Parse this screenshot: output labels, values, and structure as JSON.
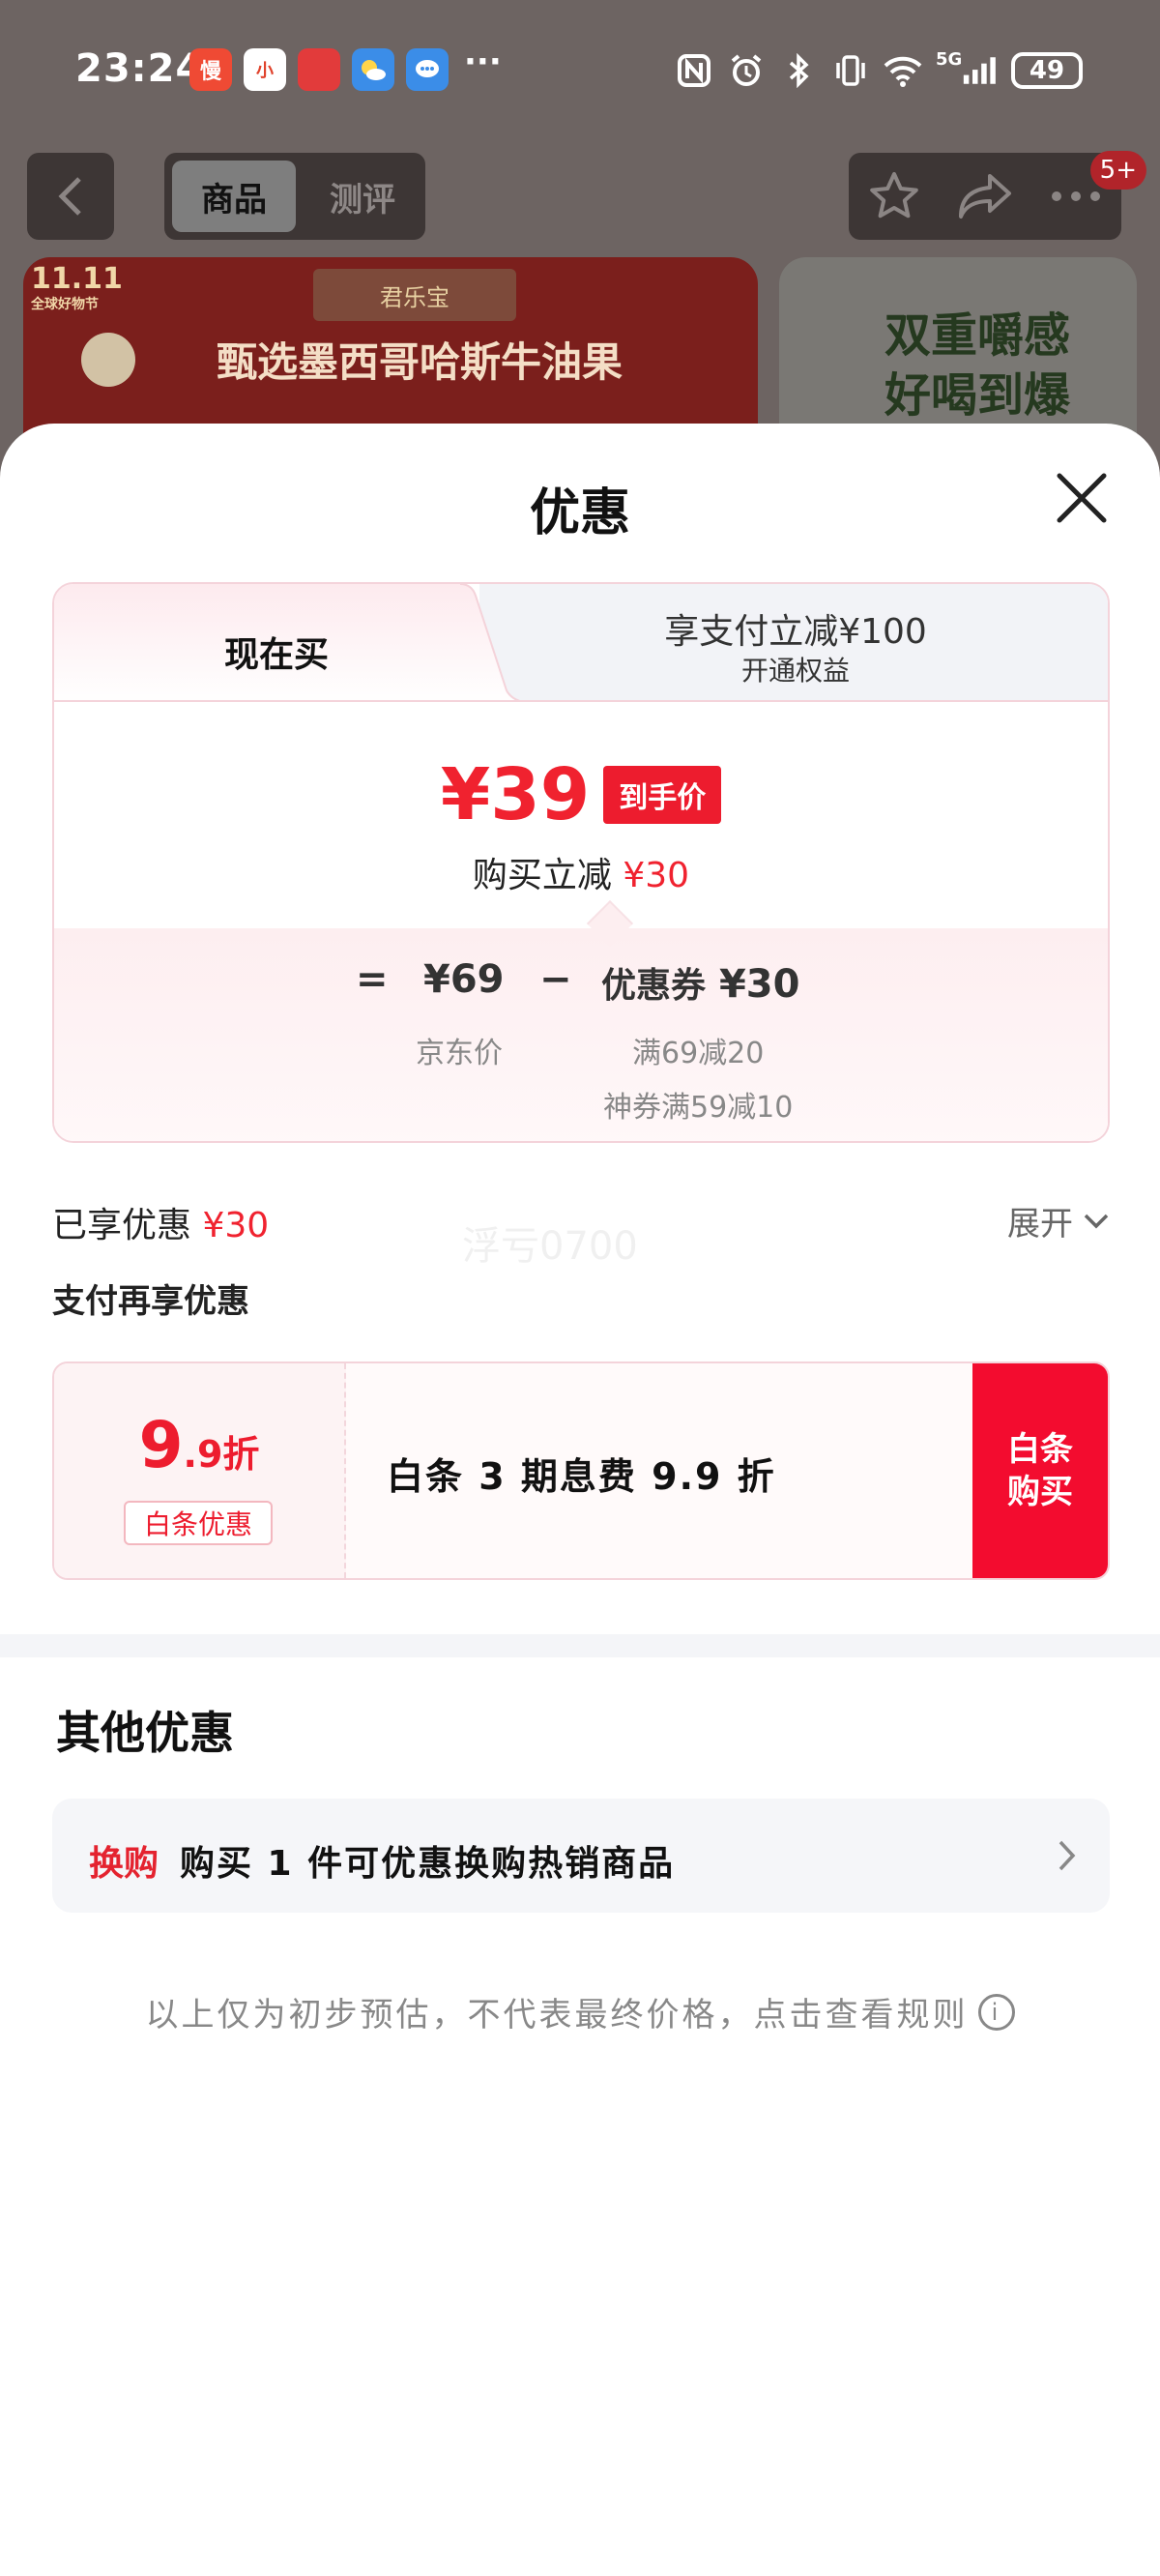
{
  "status_bar": {
    "time": "23:24",
    "app_icons": [
      {
        "name": "slow-app-icon",
        "label": "慢",
        "bg": "#ef4a34"
      },
      {
        "name": "xiaohongshu-icon",
        "label": "小",
        "bg": "#ffffff"
      },
      {
        "name": "cartoon-app-icon",
        "label": "",
        "bg": "#e23b3b"
      },
      {
        "name": "weather-icon",
        "label": "",
        "bg": "#3b8de8"
      },
      {
        "name": "message-icon",
        "label": "",
        "bg": "#3b8de8"
      }
    ],
    "more": "···",
    "battery": "49",
    "network": "5G"
  },
  "top_nav": {
    "tab_active": "商品",
    "tab_inactive": "测评",
    "notification_badge": "5+"
  },
  "banner": {
    "left_chip": "11.11",
    "left_chip_sub": "全球好物节",
    "brand": "君乐宝",
    "title": "甄选墨西哥哈斯牛油果",
    "right_text": "双重嚼感 好喝到爆"
  },
  "sheet": {
    "title": "优惠",
    "tab_now": "现在买",
    "tab_pay_title": "享支付立减¥100",
    "tab_pay_sub": "开通权益",
    "price": "¥39",
    "price_tag": "到手价",
    "instant_label": "购买立减",
    "instant_value": "¥30",
    "formula": {
      "eq": "=",
      "jd_price": "¥69",
      "minus": "−",
      "coupon_label": "优惠券",
      "coupon_value": "¥30",
      "jd_price_label": "京东价",
      "coupon_detail_1": "满69减20",
      "coupon_detail_2": "神券满59减10"
    },
    "enjoyed_label": "已享优惠",
    "enjoyed_value": "¥30",
    "expand_label": "展开",
    "pay_more_label": "支付再享优惠",
    "baitiao": {
      "discount_big": "9",
      "discount_small": ".9折",
      "tag": "白条优惠",
      "text": "白条 3 期息费 9.9 折",
      "buy_line1": "白条",
      "buy_line2": "购买"
    },
    "other_title": "其他优惠",
    "swap_tag": "换购",
    "swap_text": "购买 1 件可优惠换购热销商品",
    "footnote": "以上仅为初步预估，不代表最终价格，点击查看规则",
    "watermark": "浮亏0700"
  },
  "colors": {
    "accent_red": "#f0222f",
    "buy_red": "#f30c2f",
    "overlay_bg": "#6d6462"
  }
}
